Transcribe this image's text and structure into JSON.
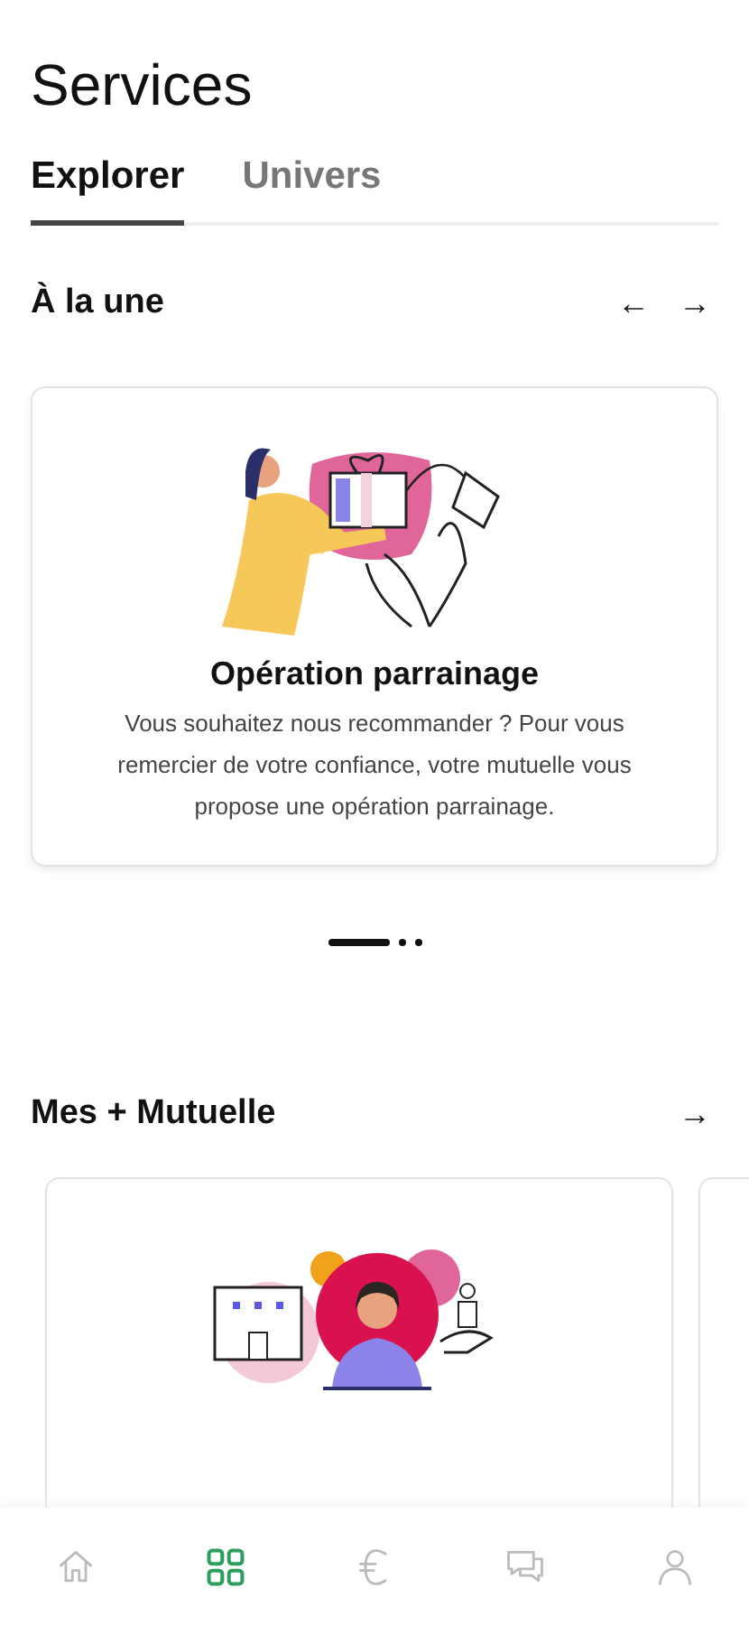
{
  "title": "Services",
  "tabs": [
    {
      "label": "Explorer",
      "selected": true
    },
    {
      "label": "Univers",
      "selected": false
    }
  ],
  "featured": {
    "title": "À la une",
    "arrows": [
      "←",
      "→"
    ],
    "cards": [
      {
        "kind": "gift",
        "title": "Opération parrainage",
        "text": "Vous souhaitez nous recommander ? Pour vous remercier de votre confiance, votre mutuelle vous propose une opération parrainage."
      }
    ],
    "pager": [
      {
        "selected": true
      },
      {
        "selected": false
      },
      {
        "selected": false
      }
    ]
  },
  "mutuelle": {
    "title": "Mes + Mutuelle",
    "arrow": "→",
    "cards": [
      {
        "kind": "support"
      },
      {
        "kind": "partial"
      }
    ]
  },
  "nav": [
    {
      "kind": "home",
      "selected": false
    },
    {
      "kind": "grid",
      "selected": true
    },
    {
      "kind": "euro",
      "selected": false
    },
    {
      "kind": "chat",
      "selected": false
    },
    {
      "kind": "user",
      "selected": false
    }
  ]
}
